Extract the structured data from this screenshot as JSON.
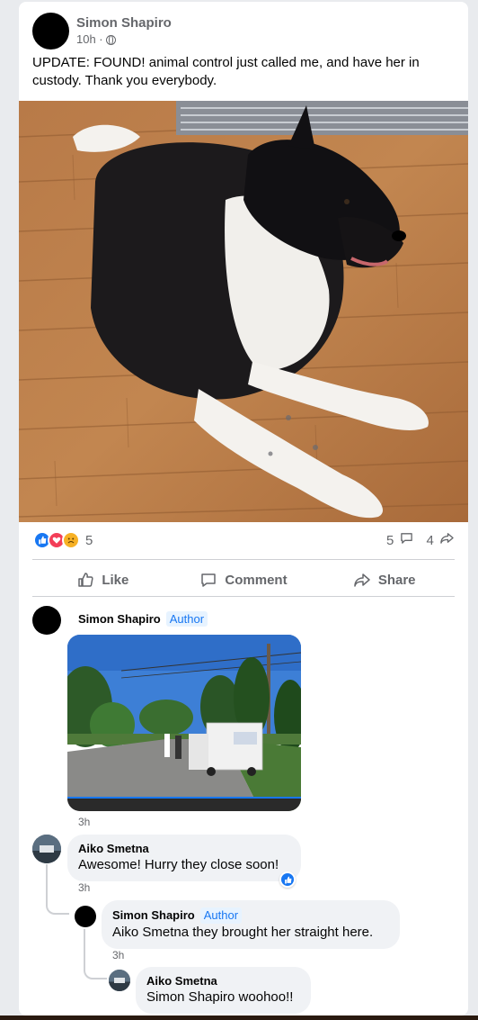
{
  "post": {
    "author": "Simon Shapiro",
    "time": "10h ·",
    "text": "UPDATE: FOUND! animal control just called me, and have her in custody. Thank you everybody.",
    "reaction_count": "5",
    "comment_count": "5",
    "share_count": "4"
  },
  "actions": {
    "like": "Like",
    "comment": "Comment",
    "share": "Share"
  },
  "comments": [
    {
      "author": "Simon Shapiro",
      "badge": "Author",
      "time": "3h"
    },
    {
      "author": "Aiko Smetna",
      "text": "Awesome! Hurry they close soon!",
      "time": "3h"
    },
    {
      "author": "Simon Shapiro",
      "badge": "Author",
      "text": "Aiko Smetna they brought her straight here.",
      "time": "3h"
    },
    {
      "author": "Aiko Smetna",
      "text": "Simon Shapiro woohoo!!"
    }
  ],
  "icons": [
    "globe-icon",
    "like-reaction-icon",
    "love-reaction-icon",
    "sad-reaction-icon",
    "comment-icon",
    "share-icon"
  ],
  "colors": {
    "accent": "#1877f2",
    "love": "#f33e58",
    "sad": "#f7b125",
    "secondary_text": "#65676b"
  }
}
